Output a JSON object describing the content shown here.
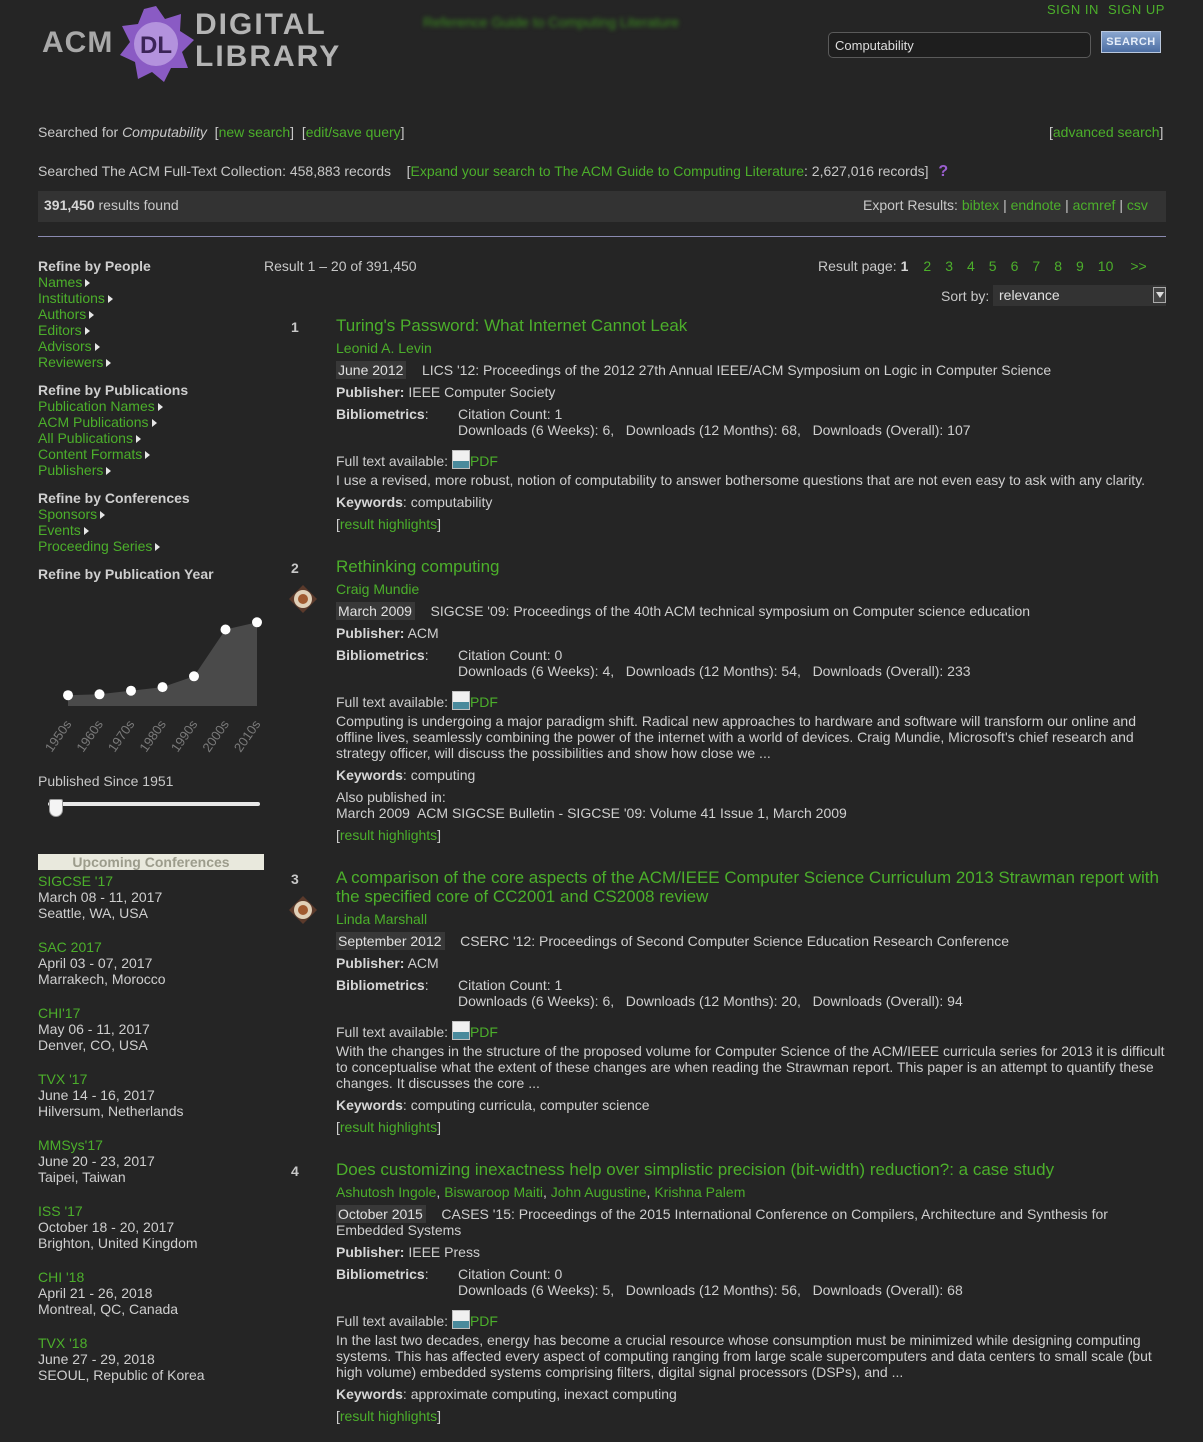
{
  "header": {
    "logo_acm": "ACM",
    "logo_dl": "DL",
    "logo_digital": "DIGITAL",
    "logo_library": "LIBRARY",
    "blurred_text": "Reference Guide to Computing Literature",
    "sign_in": "SIGN IN",
    "sign_up": "SIGN UP",
    "search_value": "Computability",
    "search_button": "SEARCH"
  },
  "query": {
    "searched_for_prefix": "Searched for",
    "term": "Computability",
    "new_search": "new search",
    "edit_save": "edit/save query",
    "advanced": "advanced search",
    "collection_text": "Searched The ACM Full-Text Collection: 458,883 records",
    "expand_link": "Expand your search to The ACM Guide to Computing Literature",
    "expand_count": ": 2,627,016 records]",
    "help_icon": "?"
  },
  "summary": {
    "count": "391,450",
    "found_label": "results found",
    "export_label": "Export Results:",
    "exports": [
      "bibtex",
      "endnote",
      "acmref",
      "csv"
    ]
  },
  "sidebar": {
    "people_heading": "Refine by People",
    "people": [
      "Names",
      "Institutions",
      "Authors",
      "Editors",
      "Advisors",
      "Reviewers"
    ],
    "pubs_heading": "Refine by Publications",
    "pubs": [
      "Publication Names",
      "ACM Publications",
      "All Publications",
      "Content Formats",
      "Publishers"
    ],
    "conf_heading": "Refine by Conferences",
    "conf": [
      "Sponsors",
      "Events",
      "Proceeding Series"
    ],
    "year_heading": "Refine by Publication Year",
    "published_since": "Published Since 1951",
    "upcoming_heading": "Upcoming Conferences",
    "upcoming": [
      {
        "name": "SIGCSE '17",
        "date": "March 08 - 11, 2017",
        "place": "Seattle, WA, USA"
      },
      {
        "name": "SAC 2017",
        "date": "April 03 - 07, 2017",
        "place": "Marrakech, Morocco"
      },
      {
        "name": "CHI'17",
        "date": "May 06 - 11, 2017",
        "place": "Denver, CO, USA"
      },
      {
        "name": "TVX '17",
        "date": "June 14 - 16, 2017",
        "place": "Hilversum, Netherlands"
      },
      {
        "name": "MMSys'17",
        "date": "June 20 - 23, 2017",
        "place": "Taipei, Taiwan"
      },
      {
        "name": "ISS '17",
        "date": "October 18 - 20, 2017",
        "place": "Brighton, United Kingdom"
      },
      {
        "name": "CHI '18",
        "date": "April 21 - 26, 2018",
        "place": "Montreal, QC, Canada"
      },
      {
        "name": "TVX '18",
        "date": "June 27 - 29, 2018",
        "place": "SEOUL, Republic of Korea"
      }
    ]
  },
  "chart_data": {
    "type": "area",
    "categories": [
      "1950s",
      "1960s",
      "1970s",
      "1980s",
      "1990s",
      "2000s",
      "2010s"
    ],
    "values": [
      0.12,
      0.13,
      0.17,
      0.21,
      0.33,
      0.85,
      0.93
    ],
    "title": "",
    "xlabel": "",
    "ylabel": "",
    "grid": false
  },
  "results_header": {
    "range_text": "Result 1 – 20 of 391,450",
    "page_label": "Result page:",
    "current_page": "1",
    "pages": [
      "2",
      "3",
      "4",
      "5",
      "6",
      "7",
      "8",
      "9",
      "10",
      ">>"
    ],
    "sort_label": "Sort by:",
    "sort_value": "relevance"
  },
  "labels": {
    "publisher": "Publisher:",
    "bibliometrics": "Bibliometrics",
    "colon": ":",
    "full_text": "Full text available:",
    "pdf": "PDF",
    "keywords": "Keywords",
    "also_published": "Also published in:",
    "highlights": "result highlights",
    "lb": "[",
    "rb": "]"
  },
  "results": [
    {
      "num": "1",
      "title": "Turing's Password: What Internet Cannot Leak",
      "authors": [
        "Leonid A. Levin"
      ],
      "date": "June 2012",
      "venue": "LICS '12: Proceedings of the 2012 27th Annual IEEE/ACM Symposium on Logic in Computer Science",
      "publisher": "IEEE Computer Society",
      "citation": "Citation Count: 1",
      "downloads": "Downloads (6 Weeks): 6,   Downloads (12 Months): 68,   Downloads (Overall): 107",
      "abstract": "I use a revised, more robust, notion of computability to answer bothersome questions that are not even easy to ask with any clarity.",
      "keywords": ": computability"
    },
    {
      "num": "2",
      "title": "Rethinking computing",
      "authors": [
        "Craig Mundie"
      ],
      "date": "March 2009",
      "venue": "SIGCSE '09: Proceedings of the 40th ACM technical symposium on Computer science education",
      "publisher": "ACM",
      "citation": "Citation Count: 0",
      "downloads": "Downloads (6 Weeks): 4,   Downloads (12 Months): 54,   Downloads (Overall): 233",
      "abstract": "Computing is undergoing a major paradigm shift. Radical new approaches to hardware and software will transform our online and offline lives, seamlessly combining the power of the internet with a world of devices. Craig Mundie, Microsoft's chief research and strategy officer, will discuss the possibilities and show how close we ...",
      "keywords": ": computing",
      "also": "March 2009  ACM SIGCSE Bulletin - SIGCSE '09: Volume 41 Issue 1, March 2009"
    },
    {
      "num": "3",
      "title": "A comparison of the core aspects of the ACM/IEEE Computer Science Curriculum 2013 Strawman report with the specified core of CC2001 and CS2008 review",
      "authors": [
        "Linda Marshall"
      ],
      "date": "September 2012",
      "venue": "CSERC '12: Proceedings of Second Computer Science Education Research Conference",
      "publisher": "ACM",
      "citation": "Citation Count: 1",
      "downloads": "Downloads (6 Weeks): 6,   Downloads (12 Months): 20,   Downloads (Overall): 94",
      "abstract": "With the changes in the structure of the proposed volume for Computer Science of the ACM/IEEE curricula series for 2013 it is difficult to conceptualise what the extent of these changes are when reading the Strawman report. This paper is an attempt to quantify these changes. It discusses the core ...",
      "keywords": ": computing curricula, computer science"
    },
    {
      "num": "4",
      "title": "Does customizing inexactness help over simplistic precision (bit-width) reduction?: a case study",
      "authors": [
        "Ashutosh Ingole",
        "Biswaroop Maiti",
        "John Augustine",
        "Krishna Palem"
      ],
      "date": "October 2015",
      "venue": "CASES '15: Proceedings of the 2015 International Conference on Compilers, Architecture and Synthesis for Embedded Systems",
      "publisher": "IEEE Press",
      "citation": "Citation Count: 0",
      "downloads": "Downloads (6 Weeks): 5,   Downloads (12 Months): 56,   Downloads (Overall): 68",
      "abstract": "In the last two decades, energy has become a crucial resource whose consumption must be minimized while designing computing systems. This has affected every aspect of computing ranging from large scale supercomputers and data centers to small scale (but high volume) embedded systems comprising filters, digital signal processors (DSPs), and ...",
      "keywords": ": approximate computing, inexact computing"
    }
  ],
  "colors": {
    "background": "#252525",
    "link": "#4caf2b",
    "text": "#cfcfcf",
    "logo_purple": "#8a5bc4"
  }
}
